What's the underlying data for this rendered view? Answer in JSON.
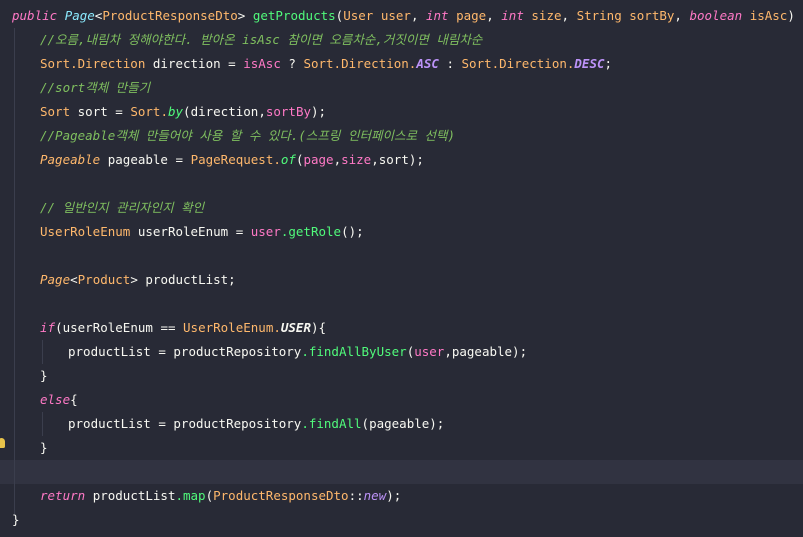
{
  "code": {
    "l1": {
      "kw": "public",
      "ty": "Page",
      "lt": "<",
      "dto": "ProductResponseDto",
      "gt": ">",
      "fn": "getProducts",
      "open": "(",
      "user_t": "User",
      "user": "user",
      "c1": ",",
      "int1": "int",
      "page": "page",
      "c2": ",",
      "int2": "int",
      "size": "size",
      "c3": ",",
      "str": "String",
      "sortBy": "sortBy",
      "c4": ",",
      "bool": "boolean",
      "isAsc": "isAsc",
      "close": ") {"
    },
    "l2": {
      "comment": "//오름,내림차 정해야한다. 받아온 isAsc 참이면 오름차순,거짓이면 내림차순"
    },
    "l3": {
      "t": "Sort.Direction",
      "v": "direction",
      "eq": "=",
      "isAsc": "isAsc",
      "q": "?",
      "a1": "Sort.Direction.",
      "asc": "ASC",
      "colon": ":",
      "a2": "Sort.Direction.",
      "desc": "DESC",
      "semi": ";"
    },
    "l4": {
      "comment": "//sort객체 만들기"
    },
    "l5": {
      "t": "Sort",
      "v": "sort",
      "eq": "=",
      "c": "Sort.",
      "m": "by",
      "o": "(",
      "a": "direction",
      "cm": ",",
      "b": "sortBy",
      "e": ");"
    },
    "l6": {
      "comment": "//Pageable객체 만들어야 사용 할 수 있다.(스프링 인터페이스로 선택)"
    },
    "l7": {
      "t": "Pageable",
      "v": "pageable",
      "eq": "=",
      "c": "PageRequest.",
      "m": "of",
      "o": "(",
      "a": "page",
      "c1": ",",
      "b": "size",
      "c2": ",",
      "d": "sort",
      "e": ");"
    },
    "l9": {
      "comment": "// 일반인지 관리자인지 확인"
    },
    "l10": {
      "t": "UserRoleEnum",
      "v": "userRoleEnum",
      "eq": "=",
      "u": "user",
      "m": ".getRole",
      "e": "();"
    },
    "l12": {
      "t": "Page",
      "lt": "<",
      "p": "Product",
      "gt": ">",
      "v": "productList;"
    },
    "l14": {
      "kw": "if",
      "o": "(userRoleEnum",
      "eq": "==",
      "c": "UserRoleEnum.",
      "cst": "USER",
      "e": "){"
    },
    "l15": {
      "v": "productList",
      "eq": "=",
      "r": "productRepository",
      "m": ".findAllByUser",
      "o": "(",
      "u": "user",
      "rest": ",pageable);"
    },
    "l16": {
      "t": "}"
    },
    "l17": {
      "kw": "else",
      "t": "{"
    },
    "l18": {
      "v": "productList",
      "eq": "=",
      "r": "productRepository",
      "m": ".findAll",
      "rest": "(pageable);"
    },
    "l19": {
      "t": "}"
    },
    "l21": {
      "kw": "return",
      "v": "productList",
      "m": ".map",
      "o": "(",
      "c": "ProductResponseDto",
      "dc": "::",
      "n": "new",
      "e": ");"
    },
    "l22": {
      "t": "}"
    }
  }
}
